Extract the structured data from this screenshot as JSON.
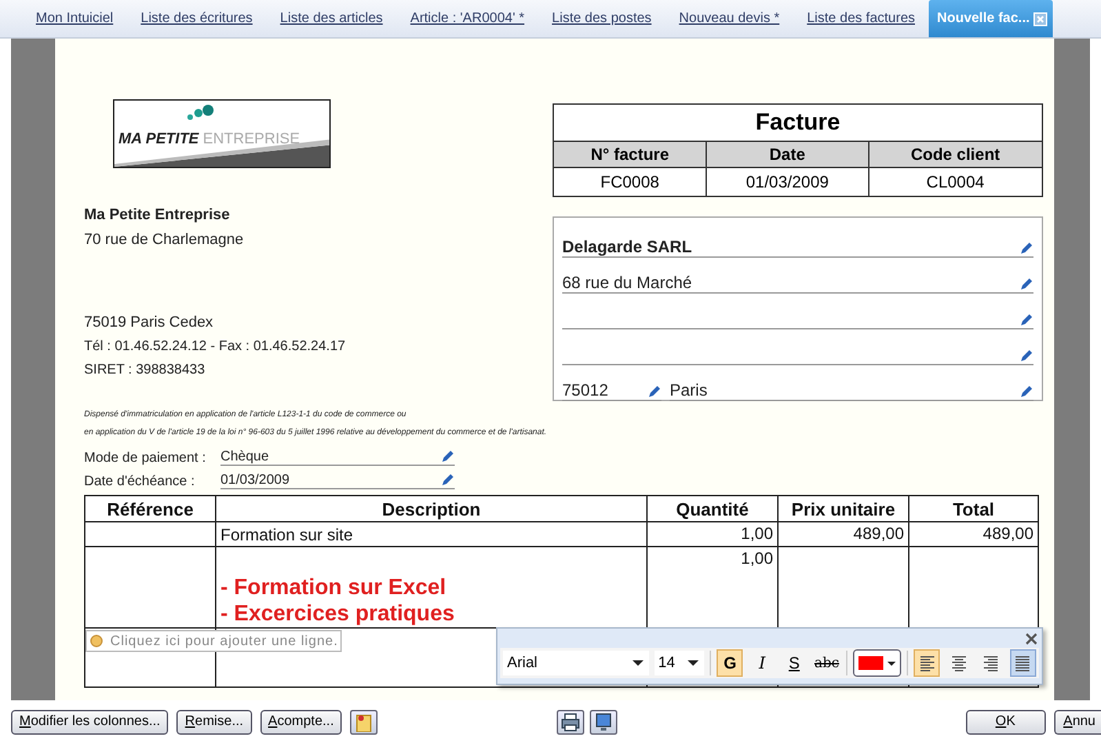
{
  "tabs": [
    {
      "label": "Mon Intuiciel",
      "selected": false
    },
    {
      "label": "Liste des écritures",
      "selected": false
    },
    {
      "label": "Liste des articles",
      "selected": false
    },
    {
      "label": "Article : 'AR0004' *",
      "selected": false
    },
    {
      "label": "Liste des postes",
      "selected": false
    },
    {
      "label": "Nouveau devis *",
      "selected": false
    },
    {
      "label": "Liste des factures",
      "selected": false
    },
    {
      "label": "Nouvelle fac...",
      "selected": true
    }
  ],
  "document": {
    "logo": {
      "bold_text": "MA PETITE",
      "light_text": "ENTREPRISE"
    },
    "company": {
      "name": "Ma Petite Entreprise",
      "address": "70 rue de Charlemagne",
      "city": "75019 Paris Cedex",
      "phone": "Tél : 01.46.52.24.12 - Fax : 01.46.52.24.17",
      "siret": "SIRET : 398838433"
    },
    "invoice_box": {
      "title": "Facture",
      "columns": [
        "N° facture",
        "Date",
        "Code client"
      ],
      "values": [
        "FC0008",
        "01/03/2009",
        "CL0004"
      ]
    },
    "client": {
      "name": "Delagarde SARL",
      "lines": [
        {
          "kind": "filled",
          "text": "68 rue du Marché"
        },
        {
          "kind": "blank"
        },
        {
          "kind": "blank"
        }
      ],
      "postcode": "75012",
      "city": "Paris"
    },
    "legal_lines": [
      "Dispensé d'immatriculation en application de l'article L123-1-1 du code de commerce ou",
      "en application du V de l'article 19 de la loi n° 96-603 du 5 juillet 1996 relative au développement du commerce et de l'artisanat."
    ],
    "fields": [
      {
        "label": "Mode de paiement :",
        "value": "Chèque"
      },
      {
        "label": "Date d'échéance :",
        "value": "01/03/2009"
      }
    ],
    "table": {
      "columns": [
        "Référence",
        "Description",
        "Quantité",
        "Prix unitaire",
        "Total"
      ],
      "rows": [
        {
          "kind": "plain",
          "cells": [
            "",
            "Formation sur site",
            "1,00",
            "489,00",
            "489,00"
          ]
        },
        {
          "kind": "highlighted",
          "cells": [
            "",
            "",
            "1,00",
            "",
            ""
          ],
          "description_lines": [
            "- Formation sur Excel",
            "- Excercices pratiques"
          ]
        }
      ],
      "add_line_hint": "Cliquez ici pour ajouter une ligne."
    }
  },
  "text_toolbar": {
    "font": "Arial",
    "size": "14",
    "styles": [
      {
        "kind": "bold",
        "label": "G",
        "selected": true
      },
      {
        "kind": "italic",
        "label": "I",
        "selected": false
      },
      {
        "kind": "underline",
        "label": "S",
        "selected": false
      },
      {
        "kind": "strike",
        "label": "abc",
        "selected": false
      }
    ],
    "alignments": [
      {
        "kind": "left",
        "selected": true,
        "hovered": false
      },
      {
        "kind": "center",
        "selected": false,
        "hovered": false
      },
      {
        "kind": "right",
        "selected": false,
        "hovered": false
      },
      {
        "kind": "justify",
        "selected": false,
        "hovered": true
      }
    ]
  },
  "bottom_bar": {
    "left_buttons": [
      "Modifier les colonnes...",
      "Remise...",
      "Acompte..."
    ],
    "right_buttons": [
      "OK",
      "Annu"
    ]
  }
}
